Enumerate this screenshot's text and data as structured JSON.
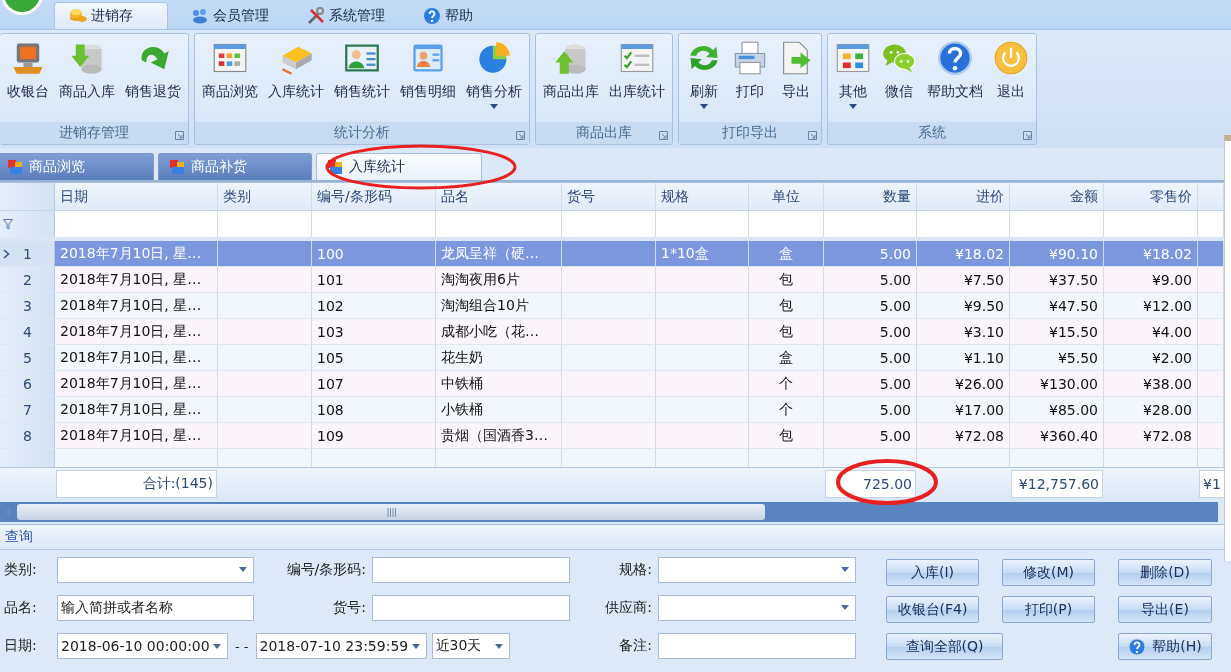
{
  "menu_tabs": [
    {
      "label": "进销存",
      "selected": true
    },
    {
      "label": "会员管理",
      "selected": false
    },
    {
      "label": "系统管理",
      "selected": false
    },
    {
      "label": "帮助",
      "selected": false
    }
  ],
  "ribbon": {
    "groups": [
      {
        "label": "进销存管理",
        "buttons": [
          {
            "label": "收银台",
            "dropdown": false
          },
          {
            "label": "商品入库",
            "dropdown": false
          },
          {
            "label": "销售退货",
            "dropdown": false
          }
        ]
      },
      {
        "label": "统计分析",
        "buttons": [
          {
            "label": "商品浏览",
            "dropdown": false
          },
          {
            "label": "入库统计",
            "dropdown": false
          },
          {
            "label": "销售统计",
            "dropdown": false
          },
          {
            "label": "销售明细",
            "dropdown": false
          },
          {
            "label": "销售分析",
            "dropdown": true
          }
        ]
      },
      {
        "label": "商品出库",
        "buttons": [
          {
            "label": "商品出库",
            "dropdown": false
          },
          {
            "label": "出库统计",
            "dropdown": false
          }
        ]
      },
      {
        "label": "打印导出",
        "buttons": [
          {
            "label": "刷新",
            "dropdown": true
          },
          {
            "label": "打印",
            "dropdown": false
          },
          {
            "label": "导出",
            "dropdown": false
          }
        ]
      },
      {
        "label": "系统",
        "buttons": [
          {
            "label": "其他",
            "dropdown": true
          },
          {
            "label": "微信",
            "dropdown": false
          },
          {
            "label": "帮助文档",
            "dropdown": false
          },
          {
            "label": "退出",
            "dropdown": false
          }
        ]
      }
    ]
  },
  "document_tabs": [
    {
      "label": "商品浏览",
      "selected": false
    },
    {
      "label": "商品补货",
      "selected": false
    },
    {
      "label": "入库统计",
      "selected": true
    }
  ],
  "grid": {
    "columns": [
      {
        "label": "日期",
        "kind": "text"
      },
      {
        "label": "类别",
        "kind": "text"
      },
      {
        "label": "编号/条形码",
        "kind": "text"
      },
      {
        "label": "品名",
        "kind": "text"
      },
      {
        "label": "货号",
        "kind": "text"
      },
      {
        "label": "规格",
        "kind": "text"
      },
      {
        "label": "单位",
        "kind": "unit"
      },
      {
        "label": "数量",
        "kind": "number"
      },
      {
        "label": "进价",
        "kind": "number"
      },
      {
        "label": "金额",
        "kind": "number"
      },
      {
        "label": "零售价",
        "kind": "number"
      },
      {
        "kind": "number"
      }
    ],
    "rows": [
      {
        "number": "1",
        "selected": true,
        "cells": [
          "2018年7月10日, 星…",
          null,
          "100",
          "龙凤呈祥（硬…",
          null,
          "1*10盒",
          "盒",
          "5.00",
          "¥18.02",
          "¥90.10",
          "¥18.02"
        ]
      },
      {
        "number": "2",
        "selected": false,
        "cells": [
          "2018年7月10日, 星…",
          null,
          "101",
          "淘淘夜用6片",
          null,
          null,
          "包",
          "5.00",
          "¥7.50",
          "¥37.50",
          "¥9.00"
        ]
      },
      {
        "number": "3",
        "selected": false,
        "cells": [
          "2018年7月10日, 星…",
          null,
          "102",
          "淘淘组合10片",
          null,
          null,
          "包",
          "5.00",
          "¥9.50",
          "¥47.50",
          "¥12.00"
        ]
      },
      {
        "number": "4",
        "selected": false,
        "cells": [
          "2018年7月10日, 星…",
          null,
          "103",
          "成都小吃（花…",
          null,
          null,
          "包",
          "5.00",
          "¥3.10",
          "¥15.50",
          "¥4.00"
        ]
      },
      {
        "number": "5",
        "selected": false,
        "cells": [
          "2018年7月10日, 星…",
          null,
          "105",
          "花生奶",
          null,
          null,
          "盒",
          "5.00",
          "¥1.10",
          "¥5.50",
          "¥2.00"
        ]
      },
      {
        "number": "6",
        "selected": false,
        "cells": [
          "2018年7月10日, 星…",
          null,
          "107",
          "中铁桶",
          null,
          null,
          "个",
          "5.00",
          "¥26.00",
          "¥130.00",
          "¥38.00"
        ]
      },
      {
        "number": "7",
        "selected": false,
        "cells": [
          "2018年7月10日, 星…",
          null,
          "108",
          "小铁桶",
          null,
          null,
          "个",
          "5.00",
          "¥17.00",
          "¥85.00",
          "¥28.00"
        ]
      },
      {
        "number": "8",
        "selected": false,
        "cells": [
          "2018年7月10日, 星…",
          null,
          "109",
          "贵烟（国酒香3…",
          null,
          null,
          "包",
          "5.00",
          "¥72.08",
          "¥360.40",
          "¥72.08"
        ]
      }
    ],
    "totals": {
      "count": "合计:(145)",
      "quantity": "725.00",
      "amount": "¥12,757.60",
      "column_12": "¥1"
    }
  },
  "query": {
    "title": "查询",
    "fields": [
      {
        "label": "类别:",
        "kind": "combo"
      },
      {
        "label": "编号/条形码:",
        "kind": "text"
      },
      {
        "label": "规格:",
        "kind": "combo"
      },
      {
        "label": "品名:",
        "kind": "text",
        "value": "输入简拼或者名称"
      },
      {
        "label": "货号:",
        "kind": "text"
      },
      {
        "label": "供应商:",
        "kind": "combo"
      },
      {
        "label": "日期:",
        "kind": "date_range",
        "from": "2018-06-10 00:00:00",
        "separator": "- -",
        "to": "2018-07-10 23:59:59",
        "preset": "近30天"
      },
      {
        "label": "备注:",
        "kind": "text"
      }
    ],
    "buttons": [
      {
        "label": "入库(I)",
        "kind": "plain"
      },
      {
        "label": "修改(M)",
        "kind": "plain"
      },
      {
        "label": "删除(D)",
        "kind": "plain"
      },
      {
        "label": "收银台(F4)",
        "kind": "plain"
      },
      {
        "label": "打印(P)",
        "kind": "plain"
      },
      {
        "label": "导出(E)",
        "kind": "plain"
      },
      {
        "label": "查询全部(Q)",
        "kind": "wide"
      },
      {
        "label": "帮助(H)",
        "kind": "help"
      }
    ]
  }
}
